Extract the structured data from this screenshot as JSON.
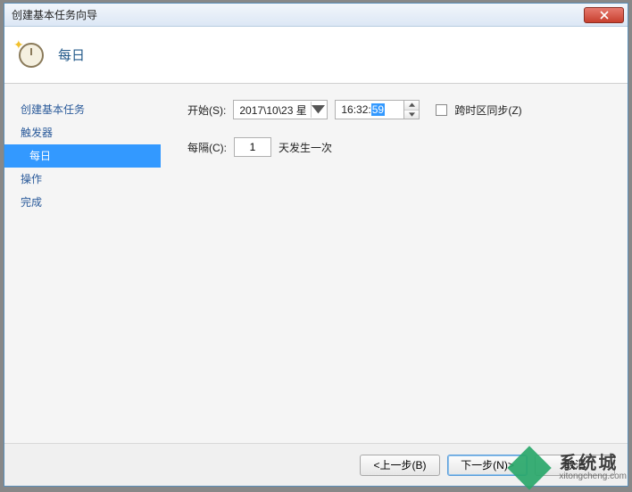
{
  "window": {
    "title": "创建基本任务向导"
  },
  "header": {
    "title": "每日"
  },
  "sidebar": {
    "items": [
      {
        "label": "创建基本任务",
        "sub": false,
        "selected": false
      },
      {
        "label": "触发器",
        "sub": false,
        "selected": false
      },
      {
        "label": "每日",
        "sub": true,
        "selected": true
      },
      {
        "label": "操作",
        "sub": false,
        "selected": false
      },
      {
        "label": "完成",
        "sub": false,
        "selected": false
      }
    ]
  },
  "form": {
    "start_label": "开始(S):",
    "date_value": "2017\\10\\23 星",
    "time_hh": "16",
    "time_mm": "32",
    "time_ss": "59",
    "timezone_sync_label": "跨时区同步(Z)",
    "interval_label": "每隔(C):",
    "interval_value": "1",
    "interval_suffix": "天发生一次"
  },
  "footer": {
    "back": "<上一步(B)",
    "next": "下一步(N)>",
    "cancel": "取消"
  },
  "watermark": {
    "name": "系统城",
    "url": "xitongcheng.com"
  }
}
